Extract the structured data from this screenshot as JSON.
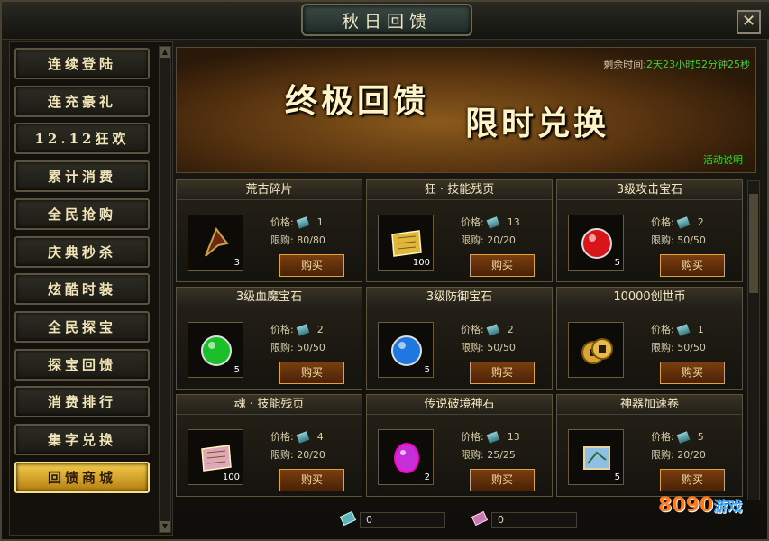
{
  "window": {
    "title": "秋日回馈",
    "close_label": "✕"
  },
  "sidebar": {
    "items": [
      {
        "label": "连续登陆",
        "active": false
      },
      {
        "label": "连充豪礼",
        "active": false
      },
      {
        "label": "12.12狂欢",
        "active": false
      },
      {
        "label": "累计消费",
        "active": false
      },
      {
        "label": "全民抢购",
        "active": false
      },
      {
        "label": "庆典秒杀",
        "active": false
      },
      {
        "label": "炫酷时装",
        "active": false
      },
      {
        "label": "全民探宝",
        "active": false
      },
      {
        "label": "探宝回馈",
        "active": false
      },
      {
        "label": "消费排行",
        "active": false
      },
      {
        "label": "集字兑换",
        "active": false
      },
      {
        "label": "回馈商城",
        "active": true
      }
    ]
  },
  "banner": {
    "slogan_left": "终极回馈",
    "slogan_right": "限时兑换",
    "timer_label": "剩余时间:",
    "timer_value": "2天23小时52分钟25秒",
    "desc_link": "活动说明"
  },
  "shop": {
    "price_label": "价格:",
    "limit_label": "限购:",
    "buy_label": "购买",
    "items": [
      {
        "name": "荒古碎片",
        "price": "1",
        "limit": "80/80",
        "qty": "3",
        "icon": "claw-fragment-icon",
        "color": "#c8a24a"
      },
      {
        "name": "狂 · 技能残页",
        "price": "13",
        "limit": "20/20",
        "qty": "100",
        "icon": "gold-scroll-icon",
        "color": "#e0b73a"
      },
      {
        "name": "3级攻击宝石",
        "price": "2",
        "limit": "50/50",
        "qty": "5",
        "icon": "red-gem-icon",
        "color": "#d8161a"
      },
      {
        "name": "3级血魔宝石",
        "price": "2",
        "limit": "50/50",
        "qty": "5",
        "icon": "green-gem-icon",
        "color": "#1bbf2a"
      },
      {
        "name": "3级防御宝石",
        "price": "2",
        "limit": "50/50",
        "qty": "5",
        "icon": "blue-gem-icon",
        "color": "#1f77e0"
      },
      {
        "name": "10000创世币",
        "price": "1",
        "limit": "50/50",
        "qty": "",
        "icon": "gold-coin-icon",
        "color": "#d9a436"
      },
      {
        "name": "魂 · 技能残页",
        "price": "4",
        "limit": "20/20",
        "qty": "100",
        "icon": "pink-scroll-icon",
        "color": "#e0a7b8"
      },
      {
        "name": "传说破境神石",
        "price": "13",
        "limit": "25/25",
        "qty": "2",
        "icon": "purple-stone-icon",
        "color": "#c62fd8"
      },
      {
        "name": "神器加速卷",
        "price": "5",
        "limit": "20/20",
        "qty": "5",
        "icon": "map-scroll-icon",
        "color": "#4e86c4"
      }
    ]
  },
  "footer": {
    "currency1": "0",
    "currency2": "0"
  },
  "watermark": {
    "text": "8090",
    "suffix": "游戏"
  }
}
